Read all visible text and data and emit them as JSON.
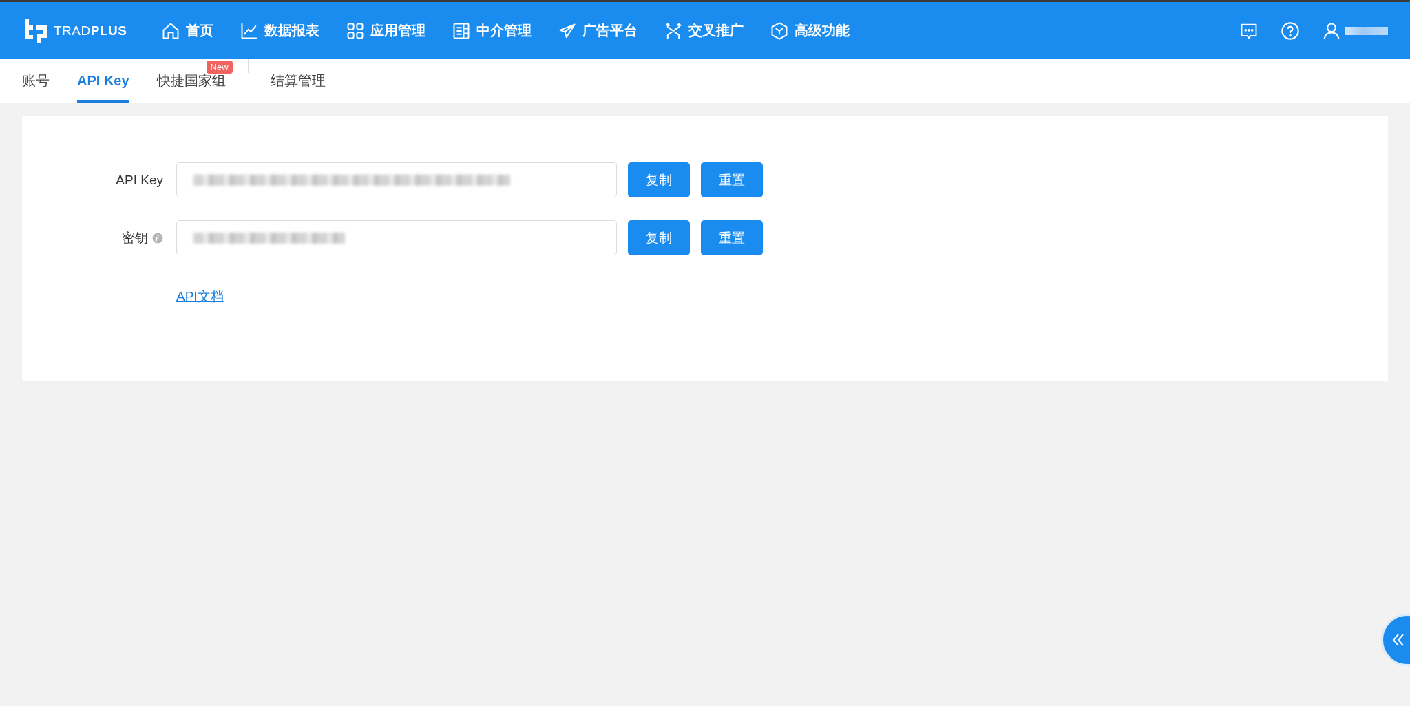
{
  "header": {
    "logo": "TRAD",
    "logo_bold": "PLUS",
    "nav": [
      {
        "label": "首页"
      },
      {
        "label": "数据报表"
      },
      {
        "label": "应用管理"
      },
      {
        "label": "中介管理"
      },
      {
        "label": "广告平台"
      },
      {
        "label": "交叉推广"
      },
      {
        "label": "高级功能"
      }
    ]
  },
  "tabs": [
    {
      "label": "账号",
      "selected": false
    },
    {
      "label": "API Key",
      "selected": true
    },
    {
      "label": "快捷国家组",
      "selected": false,
      "badge": "New"
    },
    {
      "label": "结算管理",
      "selected": false
    }
  ],
  "form": {
    "rows": [
      {
        "label": "API Key",
        "info": false,
        "buttons": [
          "复制",
          "重置"
        ]
      },
      {
        "label": "密钥",
        "info": true,
        "buttons": [
          "复制",
          "重置"
        ]
      }
    ],
    "link": "API文档"
  }
}
